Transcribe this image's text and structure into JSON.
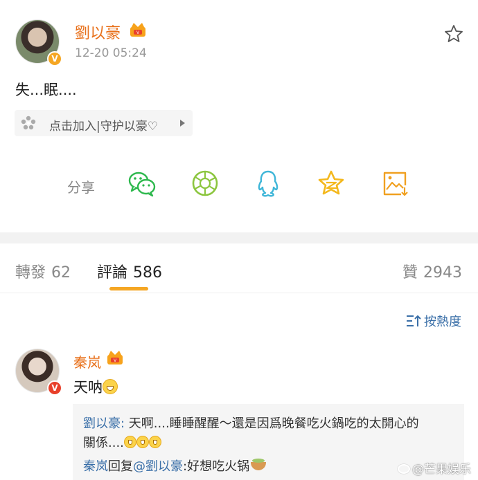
{
  "post": {
    "author": "劉以豪",
    "time": "12-20 05:24",
    "text": "失...眠....",
    "super_topic": "点击加入|守护以豪♡",
    "share_label": "分享",
    "share_icons": [
      "wechat-icon",
      "moments-icon",
      "qq-icon",
      "qzone-icon",
      "save-image-icon"
    ]
  },
  "tabs": {
    "repost_label": "轉發",
    "repost_count": "62",
    "comment_label": "評論",
    "comment_count": "586",
    "like_label": "贊",
    "like_count": "2943"
  },
  "sort": {
    "label": "按熱度"
  },
  "comment": {
    "author": "秦岚",
    "text": "天呐",
    "reply1_author": "劉以豪:",
    "reply1_text_a": " 天啊....睡睡醒醒～還是因爲晚餐吃火鍋吃的太開心的",
    "reply1_text_b": "關係....",
    "reply2_author": "秦岚",
    "reply2_verb": "回复",
    "reply2_mention": "@劉以豪",
    "reply2_text": ":好想吃火锅"
  },
  "watermark": {
    "text": "@芒果娱乐"
  },
  "colors": {
    "name_orange": "#e8701a",
    "link_blue": "#3a6fa8",
    "accent_yellow": "#f5a623",
    "verified_red": "#e8402a"
  }
}
